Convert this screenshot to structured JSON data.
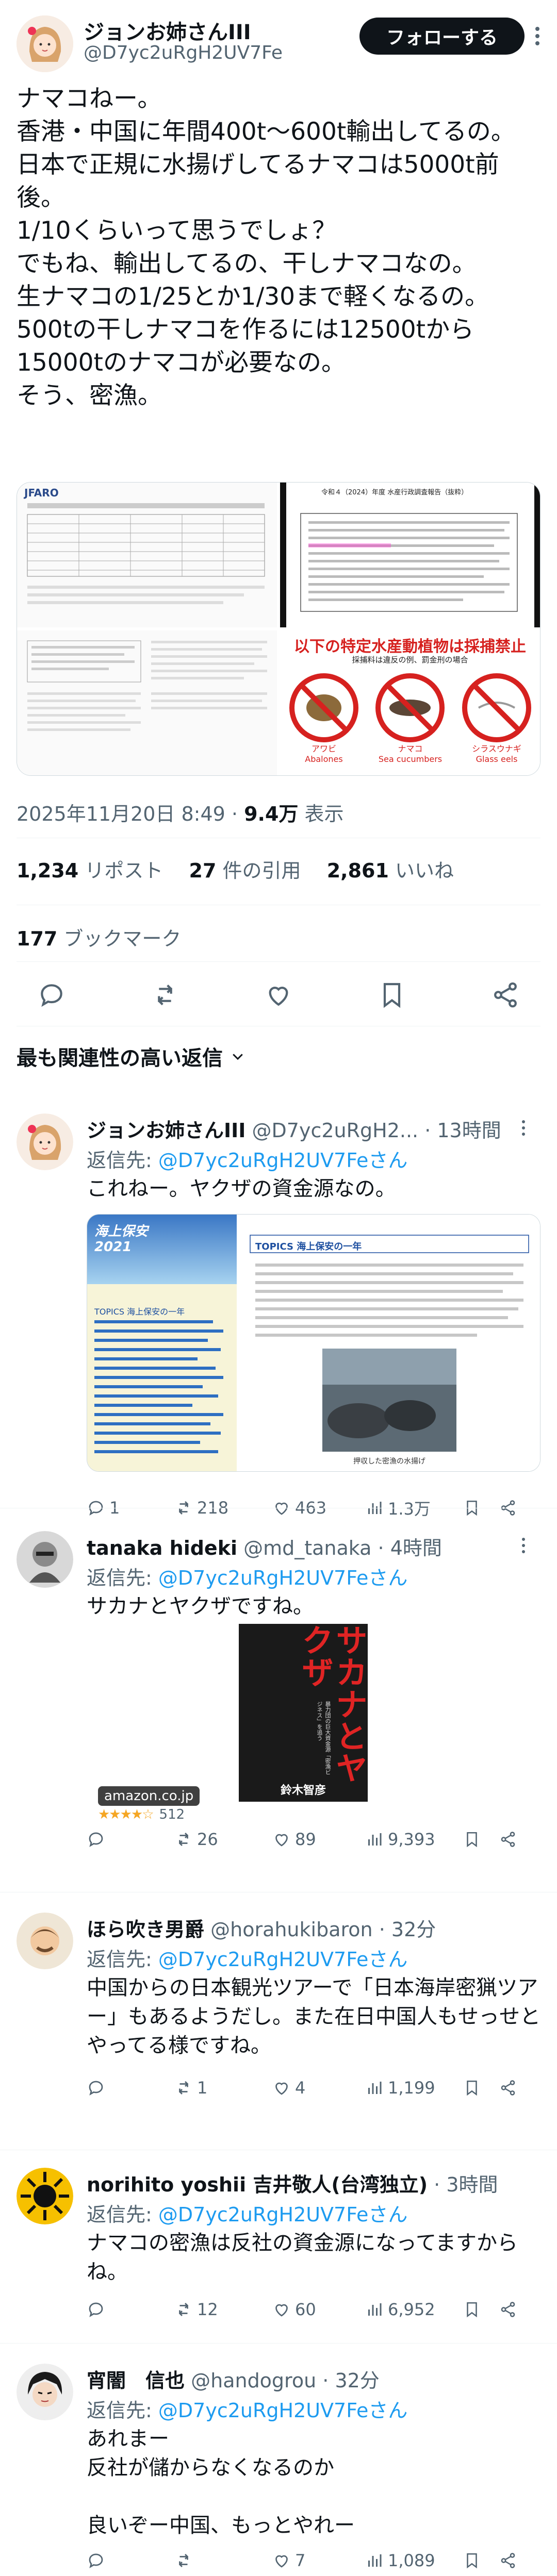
{
  "main": {
    "name": "ジョンお姉さんIII",
    "handle": "@D7yc2uRgH2UV7Fe",
    "follow_label": "フォローする",
    "text": "ナマコねー。\n香港・中国に年間400t〜600t輸出してるの。\n日本で正規に水揚げしてるナマコは5000t前後。\n1/10くらいって思うでしょ？\nでもね、輸出してるの、干しナマコなの。\n生ナマコの1/25とか1/30まで軽くなるの。\n500tの干しナマコを作るには12500tから15000tのナマコが必要なの。\nそう、密漁。",
    "media": {
      "img4_title": "以下の特定水産動植物は採捕禁止",
      "img4_sub": "採捕料は違反の例、罰金刑の場合",
      "img4_labels": [
        "アワビ\nAbalones",
        "ナマコ\nSea cucumbers",
        "シラスウナギ\nGlass eels"
      ],
      "img1_heading": "JFARO",
      "img2_heading": "令和４（2024）年度 水産行政調査報告（抜粋）"
    },
    "date": "2025年11月20日 8:49",
    "views_value": "9.4万",
    "views_label": "表示",
    "reposts_value": "1,234",
    "reposts_label": "リポスト",
    "quotes_value": "27",
    "quotes_label": "件の引用",
    "likes_value": "2,861",
    "likes_label": "いいね",
    "bookmarks_value": "177",
    "bookmarks_label": "ブックマーク"
  },
  "replies_header": "最も関連性の高い返信",
  "replies": [
    {
      "name": "ジョンお姉さんIII",
      "handle": "@D7yc2uRgH2...",
      "time": "13時間",
      "reply_to_prefix": "返信先: ",
      "reply_to_handle": "@D7yc2uRgH2UV7Feさん",
      "text": "これねー。ヤクザの資金源なの。",
      "card_left_title": "海上保安\n2021",
      "card_left_topics": "TOPICS 海上保安の一年",
      "card_right_title": "TOPICS 海上保安の一年",
      "card_photo_caption": "押収した密漁の水揚げ",
      "stats": {
        "replies": "1",
        "reposts": "218",
        "likes": "463",
        "views": "1.3万"
      }
    },
    {
      "name": "tanaka hideki",
      "handle": "@md_tanaka",
      "time": "4時間",
      "reply_to_prefix": "返信先: ",
      "reply_to_handle": "@D7yc2uRgH2UV7Feさん",
      "text": "サカナとヤクザですね。",
      "book_title": "サカナとヤクザ",
      "book_author": "鈴木智彦",
      "book_sub": "暴力団の巨大資金源「密漁ビジネス」を追う",
      "amazon_label": "amazon.co.jp",
      "rating_count": "512",
      "stats": {
        "replies": "",
        "reposts": "26",
        "likes": "89",
        "views": "9,393"
      }
    },
    {
      "name": "ほら吹き男爵",
      "handle": "@horahukibaron",
      "time": "32分",
      "reply_to_prefix": "返信先: ",
      "reply_to_handle": "@D7yc2uRgH2UV7Feさん",
      "text": "中国からの日本観光ツアーで「日本海岸密猟ツアー」もあるようだし。また在日中国人もせっせとやってる様ですね。",
      "stats": {
        "replies": "",
        "reposts": "1",
        "likes": "4",
        "views": "1,199"
      }
    },
    {
      "name": "norihito yoshii 吉井敬人(台湾独立)",
      "handle": "",
      "time": "3時間",
      "reply_to_prefix": "返信先: ",
      "reply_to_handle": "@D7yc2uRgH2UV7Feさん",
      "text": "ナマコの密漁は反社の資金源になってますからね。",
      "stats": {
        "replies": "",
        "reposts": "12",
        "likes": "60",
        "views": "6,952"
      }
    },
    {
      "name": "宵闇　信也",
      "handle": "@handogrou",
      "time": "32分",
      "reply_to_prefix": "返信先: ",
      "reply_to_handle": "@D7yc2uRgH2UV7Feさん",
      "text": "あれまー\n反社が儲からなくなるのか\n\n良いぞー中国、もっとやれー",
      "stats": {
        "replies": "",
        "reposts": "",
        "likes": "7",
        "views": "1,089"
      }
    }
  ],
  "colors": {
    "accent": "#1d9bf0",
    "text": "#0f1419",
    "muted": "#536471",
    "border": "#eff3f4"
  }
}
